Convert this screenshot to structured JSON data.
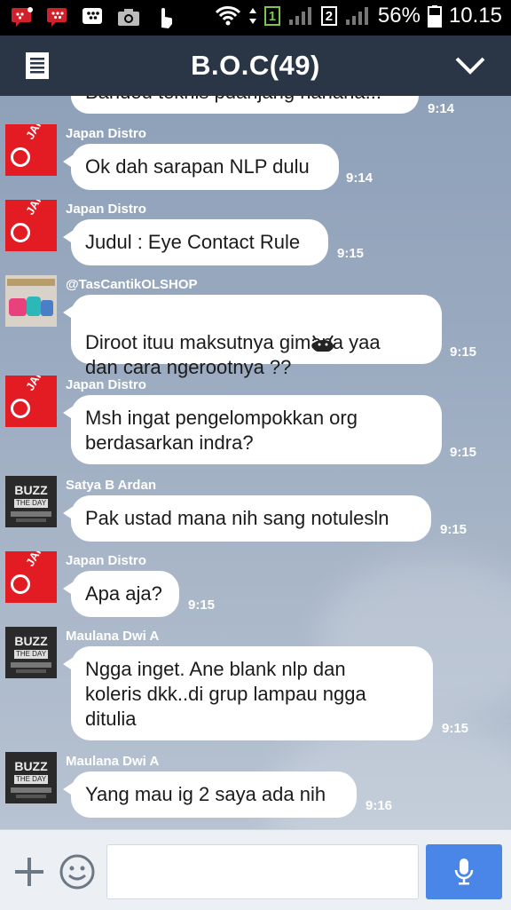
{
  "status_bar": {
    "left_icons": [
      "bbm-notification-icon",
      "bbm-icon",
      "blackberry-icon",
      "camera-icon",
      "touch-icon"
    ],
    "sim1_label": "1",
    "sim2_label": "2",
    "battery": "56%",
    "time": "10.15"
  },
  "header": {
    "title": "B.O.C(49)"
  },
  "messages": [
    {
      "sender": "",
      "text": "Bandou teknis pdanjang hahaha...",
      "time": "9:14"
    },
    {
      "sender": "Japan Distro",
      "text": "Ok dah sarapan NLP dulu",
      "time": "9:14"
    },
    {
      "sender": "Japan Distro",
      "text": "Judul : Eye Contact Rule",
      "time": "9:15"
    },
    {
      "sender": "@TasCantikOLSHOP",
      "text": "Diroot ituu maksutnya gimana yaa\ndan cara ngerootnya ??",
      "time": "9:15"
    },
    {
      "sender": "Japan Distro",
      "text": "Msh ingat pengelompokkan org\nberdasarkan indra?",
      "time": "9:15"
    },
    {
      "sender": "Satya B Ardan",
      "text": "Pak ustad mana nih sang notulesln",
      "time": "9:15"
    },
    {
      "sender": "Japan Distro",
      "text": "Apa aja?",
      "time": "9:15"
    },
    {
      "sender": "Maulana Dwi A",
      "text": "Ngga inget. Ane blank nlp dan\nkoleris dkk..di grup lampau ngga\nditulia",
      "time": "9:15"
    },
    {
      "sender": "Maulana Dwi A",
      "text": "Yang mau ig 2 saya ada nih",
      "time": "9:16"
    }
  ],
  "avatar_labels": {
    "japan": "JAPAN DISTRO",
    "buzz_top": "BUZZ",
    "buzz_sub": "THE DAY"
  },
  "input": {
    "value": "",
    "placeholder": ""
  },
  "colors": {
    "header_bg": "#2a3646",
    "accent_mic": "#4a86e8",
    "bubble": "#ffffff"
  }
}
